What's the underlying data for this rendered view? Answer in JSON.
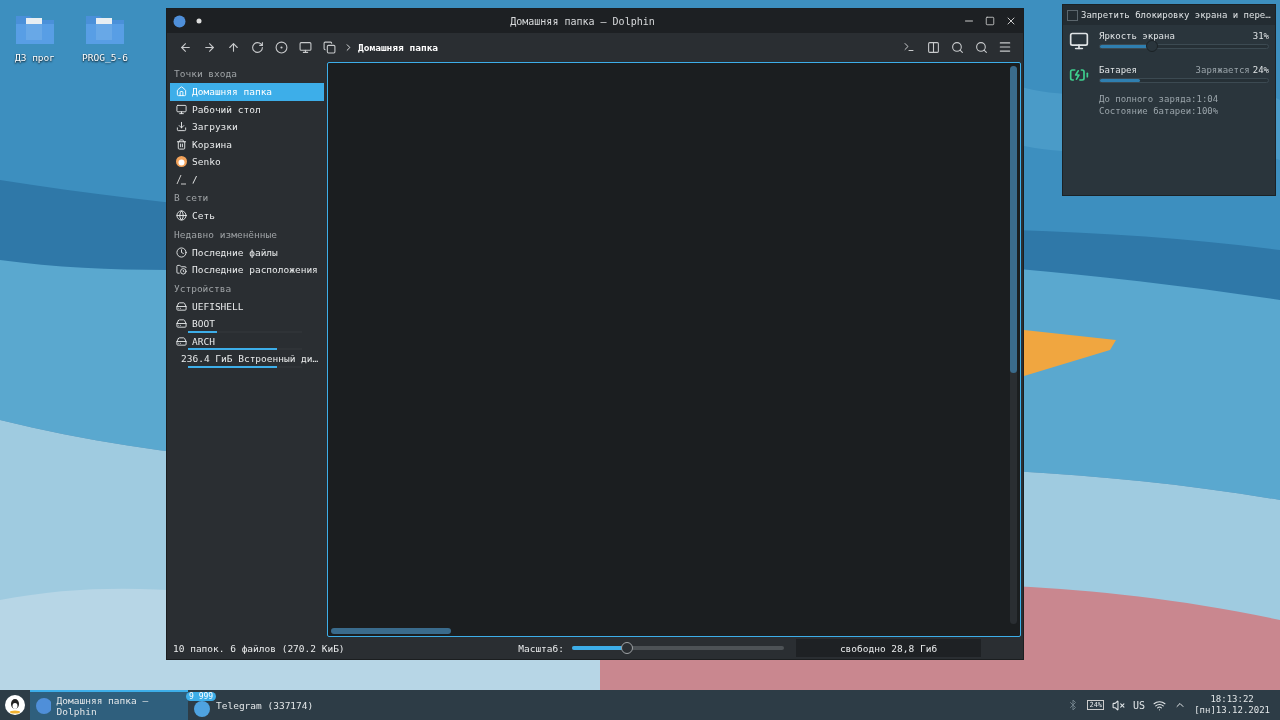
{
  "desktop_icons": [
    {
      "label": "ДЗ прог"
    },
    {
      "label": "PROG_5-6"
    }
  ],
  "window": {
    "title": "Домашняя папка — Dolphin",
    "breadcrumb": "Домашняя папка",
    "places": [
      {
        "title": "Точки входа",
        "items": [
          {
            "label": "Домашняя папка",
            "selected": true
          },
          {
            "label": "Рабочий стол",
            "selected": false
          },
          {
            "label": "Загрузки",
            "selected": false
          },
          {
            "label": "Корзина",
            "selected": false
          },
          {
            "label": "Senko",
            "selected": false
          },
          {
            "label": "/",
            "selected": false
          }
        ]
      },
      {
        "title": "В сети",
        "items": [
          {
            "label": "Сеть",
            "selected": false
          }
        ]
      },
      {
        "title": "Недавно изменённые",
        "items": [
          {
            "label": "Последние файлы",
            "selected": false
          },
          {
            "label": "Последние расположения",
            "selected": false
          }
        ]
      },
      {
        "title": "Устройства",
        "items": [
          {
            "label": "UEFISHELL",
            "selected": false
          },
          {
            "label": "BOOT",
            "selected": false,
            "level": 0.25
          },
          {
            "label": "ARCH",
            "selected": false,
            "level": 0.78
          },
          {
            "label": "236.4 ГиБ Встроенный ди…",
            "selected": false,
            "level": 0.78
          }
        ]
      }
    ],
    "status": {
      "summary": "10 папок. 6 файлов (270.2 КиБ)",
      "zoom_label": "Масштаб:",
      "zoom": {
        "level": 0.26
      },
      "free": "свободно 28,8 Гиб"
    }
  },
  "popup": {
    "inhibit": {
      "label": "Запретить блокировку экрана и пере…",
      "checked": false
    },
    "brightness": {
      "label": "Яркость экрана",
      "reading": "31%",
      "level": 0.31
    },
    "battery": {
      "label": "Батарея",
      "status": "Заряжается",
      "reading": "24%",
      "level": 0.24,
      "details": [
        "До полного заряда:1:04",
        "Состояние батареи:100%"
      ]
    }
  },
  "taskbar": {
    "tasks": [
      {
        "label": "Домашняя папка — Dolphin",
        "selected": true
      },
      {
        "label": "Telegram (337174)",
        "selected": false,
        "badge": "9 999"
      }
    ],
    "tray": {
      "battery": "24%",
      "layout": "US",
      "time": "18:13:22",
      "date": "[пн]13.12.2021"
    }
  }
}
